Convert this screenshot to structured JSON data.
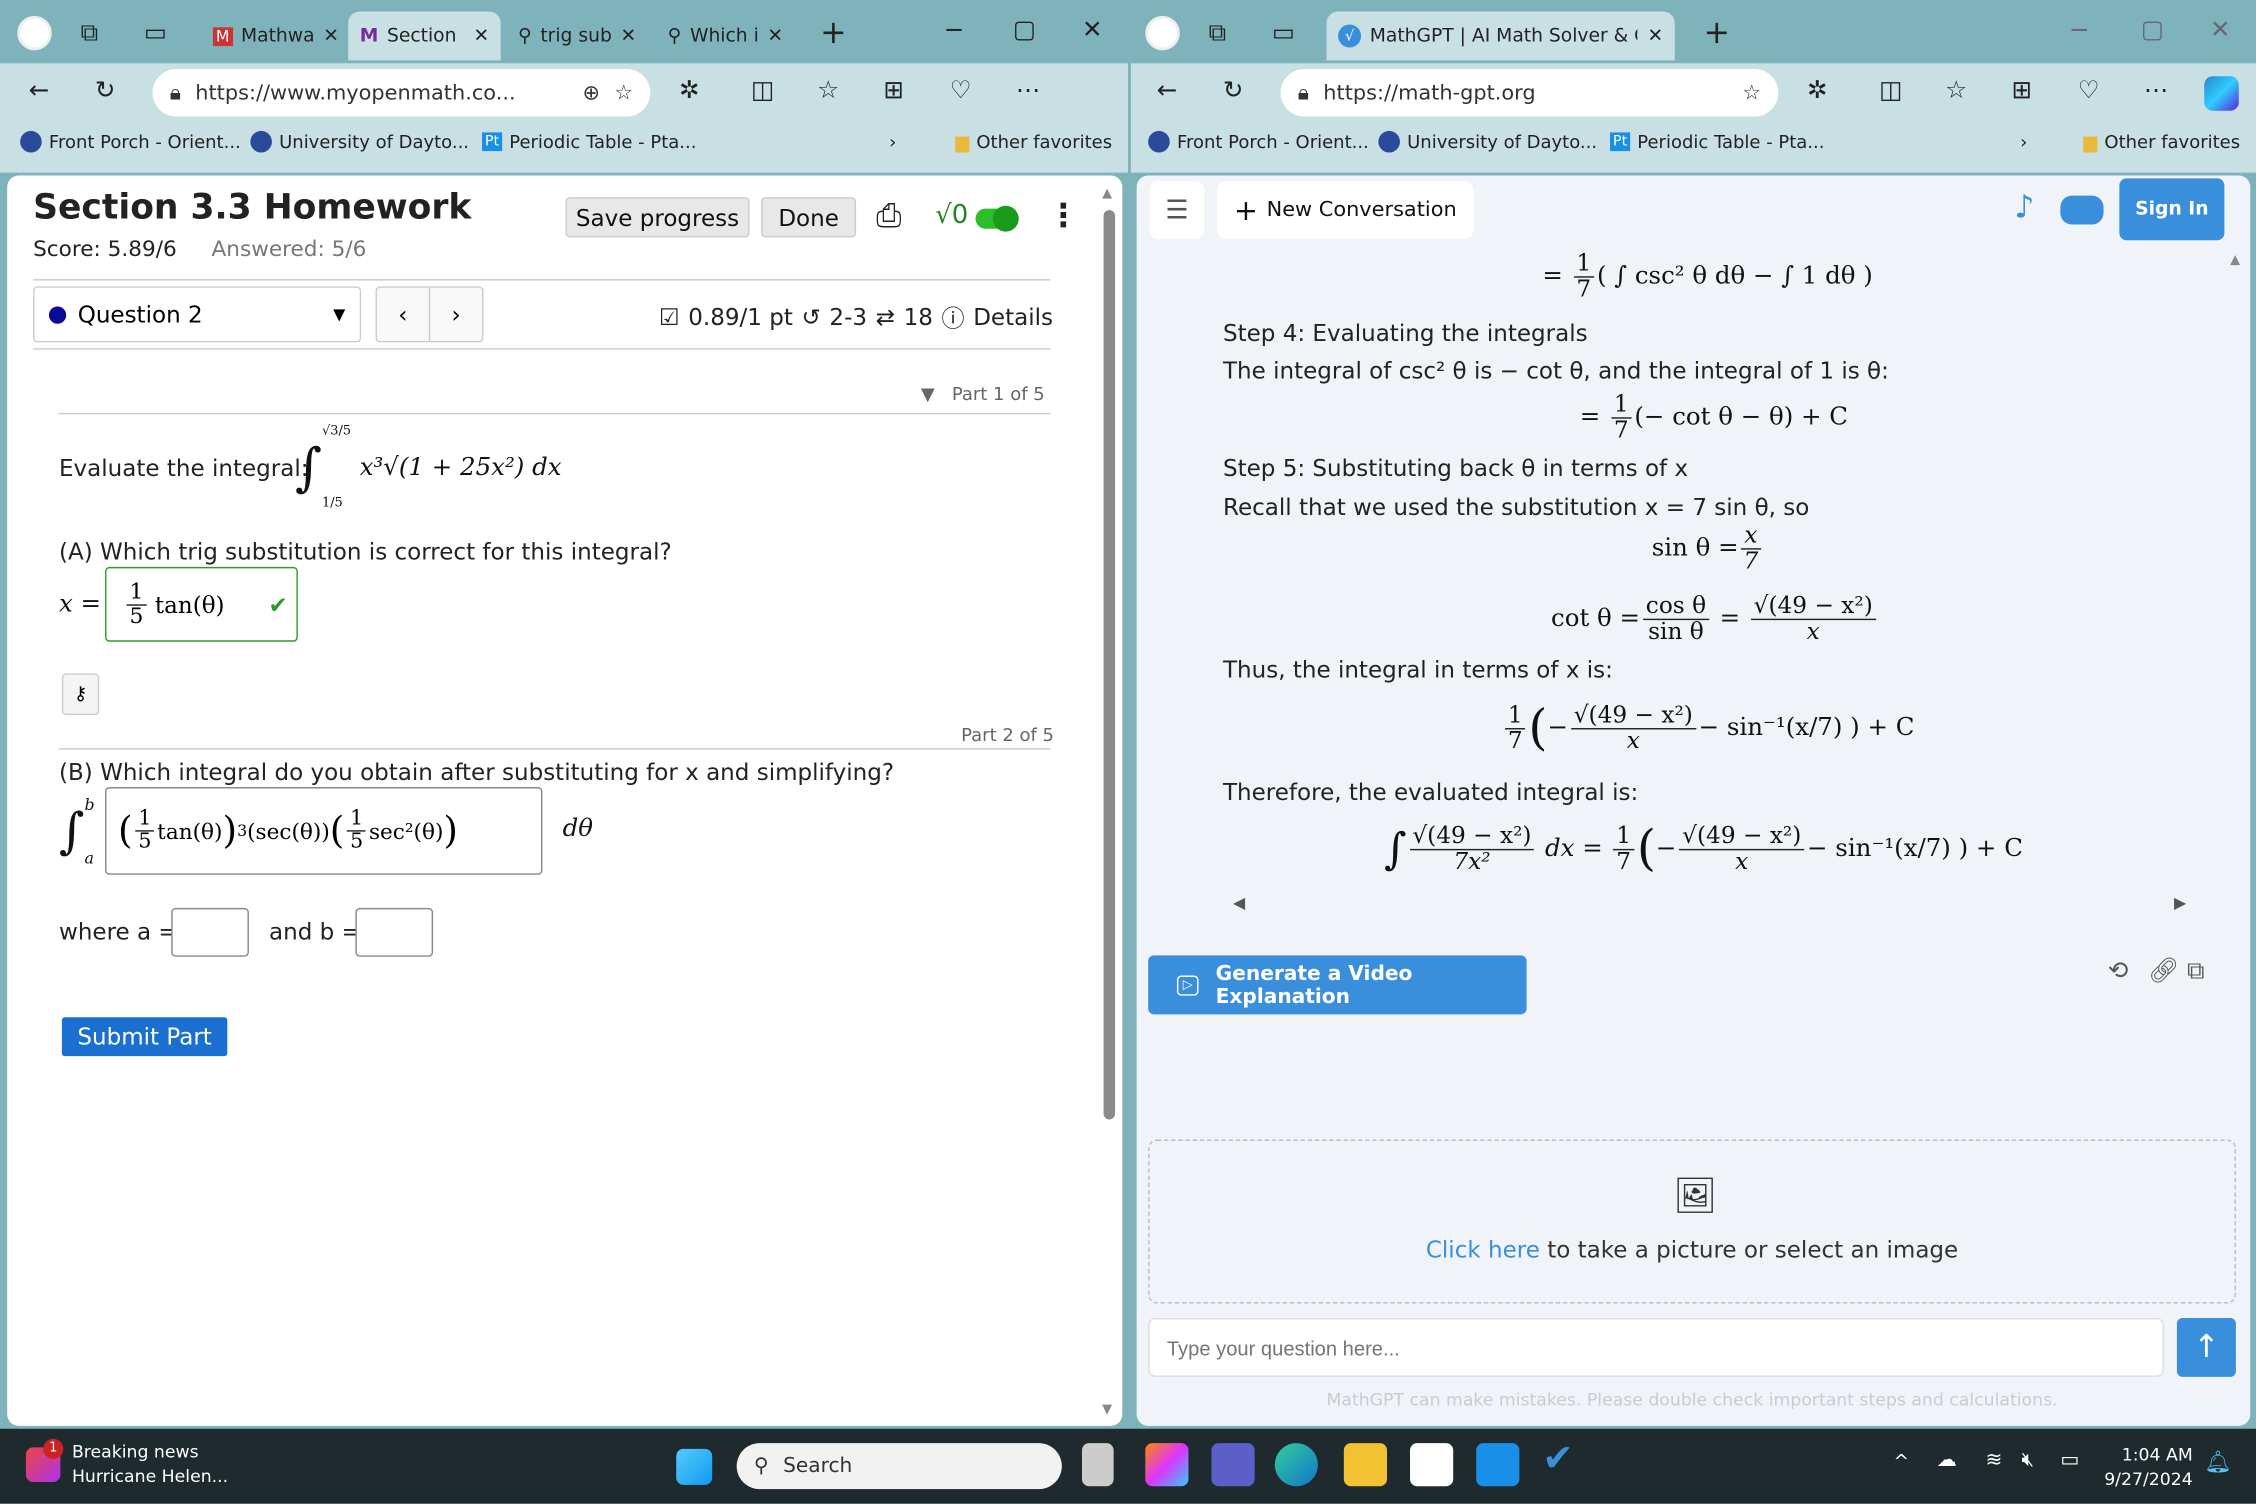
{
  "left_browser": {
    "tabs": [
      {
        "label": "Mathwa",
        "icon": "mathway-icon"
      },
      {
        "label": "Section",
        "icon": "myopenmath-icon",
        "active": true
      },
      {
        "label": "trig sub",
        "icon": "search-icon"
      },
      {
        "label": "Which i",
        "icon": "search-icon"
      }
    ],
    "url": "https://www.myopenmath.co...",
    "favorites": [
      "Front Porch - Orient...",
      "University of Dayto...",
      "Periodic Table - Pta..."
    ],
    "other_favorites": "Other favorites"
  },
  "right_browser": {
    "tabs": [
      {
        "label": "MathGPT | AI Math Solver & Calcu",
        "icon": "mathgpt-icon",
        "active": true
      }
    ],
    "url": "https://math-gpt.org",
    "favorites": [
      "Front Porch - Orient...",
      "University of Dayto...",
      "Periodic Table - Pta..."
    ],
    "other_favorites": "Other favorites"
  },
  "homework": {
    "title": "Section 3.3 Homework",
    "score": "Score: 5.89/6",
    "answered": "Answered: 5/6",
    "save_label": "Save progress",
    "done_label": "Done",
    "sqrt_label": "√0",
    "toggle_on": true,
    "question_select": "Question 2",
    "points": "0.89/1 pt",
    "attempts": "2-3",
    "retries": "18",
    "details": "Details",
    "part1": "Part 1 of 5",
    "part2": "Part 2 of 5",
    "evaluate_label": "Evaluate the integral:",
    "integral_upper": "√3/5",
    "integral_lower": "1/5",
    "integrand": "x³√(1 + 25x²)  dx",
    "qa": "(A) Which trig substitution is correct for this integral?",
    "qa_lhs": "x =",
    "qa_answer_num": "1",
    "qa_answer_den": "5",
    "qa_answer_fn": "tan(θ)",
    "qb": "(B) Which integral do you obtain after substituting for x and simplifying?",
    "qb_lower": "a",
    "qb_upper": "b",
    "qb_expr1": "tan(θ)",
    "qb_exp": "3",
    "qb_expr2": "(sec(θ))",
    "qb_expr3": "sec²(θ)",
    "qb_frac_num": "1",
    "qb_frac_den": "5",
    "qb_dtheta": "dθ",
    "where_a": "where a =",
    "and_b": "and b =",
    "a_value": "",
    "b_value": "",
    "submit": "Submit Part"
  },
  "mathgpt": {
    "new_conversation": "New Conversation",
    "sign_in": "Sign In",
    "line0_frac": [
      "1",
      "7"
    ],
    "line0": "( ∫ csc² θ dθ − ∫ 1 dθ )",
    "step4": "Step 4: Evaluating the integrals",
    "step4_text": "The integral of csc² θ is − cot θ, and the integral of 1 is θ:",
    "step4_res": "(− cot θ − θ) + C",
    "step5": "Step 5: Substituting back θ in terms of x",
    "recall": "Recall that we used the substitution x = 7 sin θ, so",
    "sin_eq": "sin θ =",
    "sin_frac": [
      "x",
      "7"
    ],
    "cot_eq": "cot θ =",
    "cot_frac": [
      "cos θ",
      "sin θ"
    ],
    "cot_frac2": [
      "√(49 − x²)",
      "x"
    ],
    "thus": "Thus, the integral in terms of x is:",
    "thus_frac": [
      "√(49 − x²)",
      "x"
    ],
    "thus_tail": "− sin⁻¹(x/7) ) + C",
    "therefore": "Therefore, the evaluated integral is:",
    "final_lhs": [
      "√(49 − x²)",
      "7x²"
    ],
    "final_dx": "dx =",
    "generate_video": "Generate a Video Explanation",
    "click_here": "Click here",
    "upload_text": " to take a picture or select an image",
    "input_placeholder": "Type your question here...",
    "disclaimer": "MathGPT can make mistakes. Please double check important steps and calculations."
  },
  "taskbar": {
    "news_title": "Breaking news",
    "news_sub": "Hurricane Helen...",
    "news_badge": "1",
    "search": "Search",
    "time": "1:04 AM",
    "date": "9/27/2024"
  },
  "colors": {
    "accent_blue": "#3a8fdc",
    "submit_blue": "#1a6fd1",
    "correct_green": "#2e9b2e",
    "teal_frame": "#7fb3bc"
  }
}
